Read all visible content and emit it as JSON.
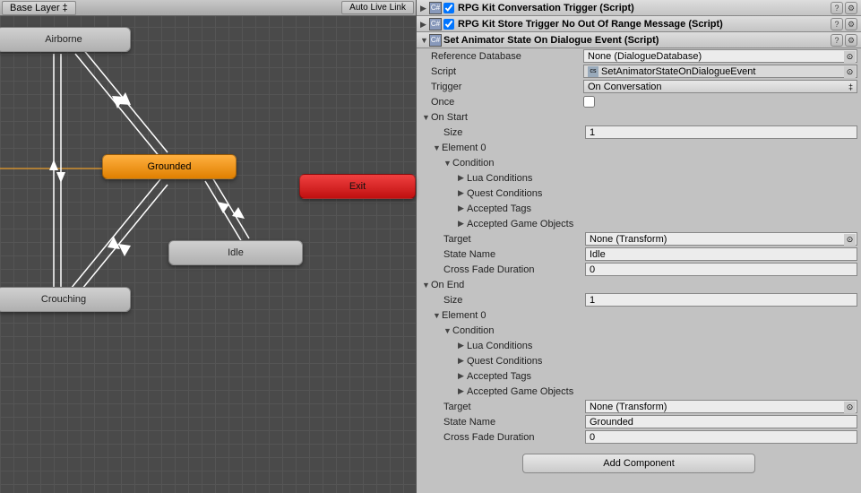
{
  "animator": {
    "layer_dropdown": "Base Layer",
    "auto_live_link": "Auto Live Link",
    "states": {
      "airborne": "Airborne",
      "grounded": "Grounded",
      "exit": "Exit",
      "idle": "Idle",
      "crouching": "Crouching"
    }
  },
  "inspector": {
    "comp1": {
      "title": "RPG Kit Conversation Trigger (Script)"
    },
    "comp2": {
      "title": "RPG Kit Store Trigger No Out Of Range Message (Script)"
    },
    "comp3": {
      "title": "Set Animator State On Dialogue Event (Script)",
      "reference_database": {
        "label": "Reference Database",
        "value": "None (DialogueDatabase)"
      },
      "script": {
        "label": "Script",
        "value": "SetAnimatorStateOnDialogueEvent"
      },
      "trigger": {
        "label": "Trigger",
        "value": "On Conversation"
      },
      "once": {
        "label": "Once"
      },
      "on_start": {
        "label": "On Start",
        "size_label": "Size",
        "size_value": "1",
        "elements": [
          {
            "label": "Element 0",
            "condition": {
              "label": "Condition",
              "lua": "Lua Conditions",
              "quest": "Quest Conditions",
              "tags": "Accepted Tags",
              "objects": "Accepted Game Objects"
            },
            "target": {
              "label": "Target",
              "value": "None (Transform)"
            },
            "state_name": {
              "label": "State Name",
              "value": "Idle"
            },
            "cross_fade": {
              "label": "Cross Fade Duration",
              "value": "0"
            }
          }
        ]
      },
      "on_end": {
        "label": "On End",
        "size_label": "Size",
        "size_value": "1",
        "elements": [
          {
            "label": "Element 0",
            "condition": {
              "label": "Condition",
              "lua": "Lua Conditions",
              "quest": "Quest Conditions",
              "tags": "Accepted Tags",
              "objects": "Accepted Game Objects"
            },
            "target": {
              "label": "Target",
              "value": "None (Transform)"
            },
            "state_name": {
              "label": "State Name",
              "value": "Grounded"
            },
            "cross_fade": {
              "label": "Cross Fade Duration",
              "value": "0"
            }
          }
        ]
      }
    },
    "add_component": "Add Component"
  }
}
